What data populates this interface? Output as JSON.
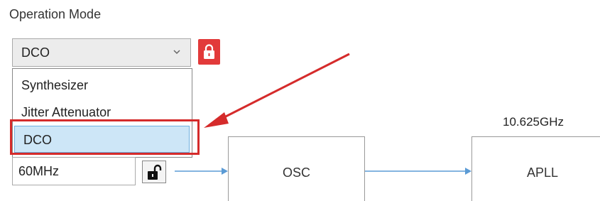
{
  "operation_mode": {
    "title": "Operation Mode",
    "selected_value": "DCO",
    "options": [
      "Synthesizer",
      "Jitter Attenuator",
      "DCO"
    ]
  },
  "frequency_input": {
    "value": "60MHz"
  },
  "blocks": {
    "osc_label": "OSC",
    "apll_label": "APLL",
    "apll_frequency": "10.625GHz"
  },
  "colors": {
    "accent_red": "#d52b2b",
    "lock_red": "#e23a3a",
    "selection_blue": "#cde6f7",
    "arrow_blue": "#5b9bd5"
  },
  "icons": {
    "lock": "lock-icon",
    "unlock": "unlock-icon",
    "chevron": "chevron-down-icon"
  }
}
